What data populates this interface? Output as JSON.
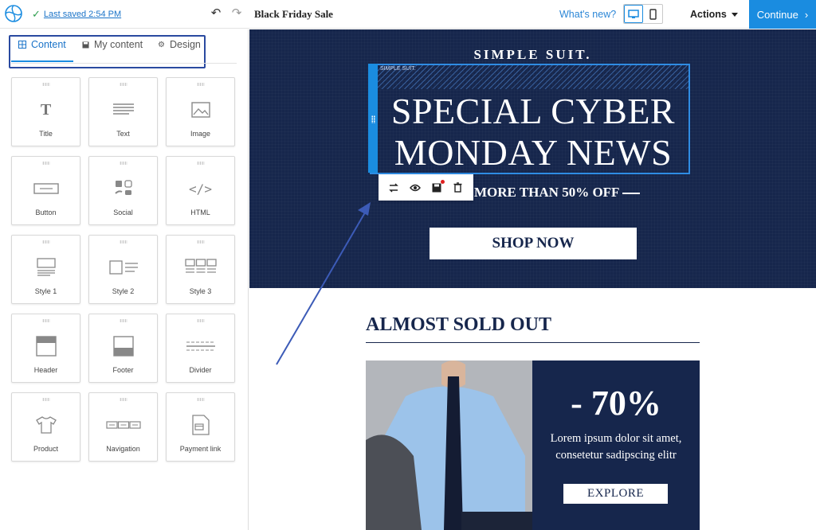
{
  "header": {
    "saved_label": "Last saved 2:54 PM",
    "document_title": "Black Friday Sale",
    "whats_new": "What's new?",
    "actions_label": "Actions",
    "continue_label": "Continue"
  },
  "sidebar": {
    "tabs": [
      {
        "label": "Content",
        "active": true
      },
      {
        "label": "My content",
        "active": false
      },
      {
        "label": "Design",
        "active": false
      }
    ],
    "blocks": [
      {
        "label": "Title",
        "icon": "title-icon"
      },
      {
        "label": "Text",
        "icon": "text-icon"
      },
      {
        "label": "Image",
        "icon": "image-icon"
      },
      {
        "label": "Button",
        "icon": "button-icon"
      },
      {
        "label": "Social",
        "icon": "social-icon"
      },
      {
        "label": "HTML",
        "icon": "code-icon"
      },
      {
        "label": "Style 1",
        "icon": "style1-icon"
      },
      {
        "label": "Style 2",
        "icon": "style2-icon"
      },
      {
        "label": "Style 3",
        "icon": "style3-icon"
      },
      {
        "label": "Header",
        "icon": "header-icon"
      },
      {
        "label": "Footer",
        "icon": "footer-icon"
      },
      {
        "label": "Divider",
        "icon": "divider-icon"
      },
      {
        "label": "Product",
        "icon": "tshirt-icon"
      },
      {
        "label": "Navigation",
        "icon": "navigation-icon"
      },
      {
        "label": "Payment link",
        "icon": "payment-link-icon"
      }
    ]
  },
  "email": {
    "brand": "SIMPLE SUIT.",
    "selection_tag": "SIMPLE SUIT.",
    "headline_line1": "SPECIAL CYBER",
    "headline_line2": "MONDAY NEWS",
    "offer": "MORE THAN 50% OFF",
    "shop_button": "SHOP NOW",
    "section_title": "ALMOST SOLD OUT",
    "discount": "- 70%",
    "lorem": "Lorem ipsum dolor sit amet, consetetur sadipscing elitr",
    "explore_button": "EXPLORE"
  },
  "colors": {
    "accent": "#1a8ce0",
    "navy": "#16264c",
    "highlight_border": "#2a4aa0"
  }
}
